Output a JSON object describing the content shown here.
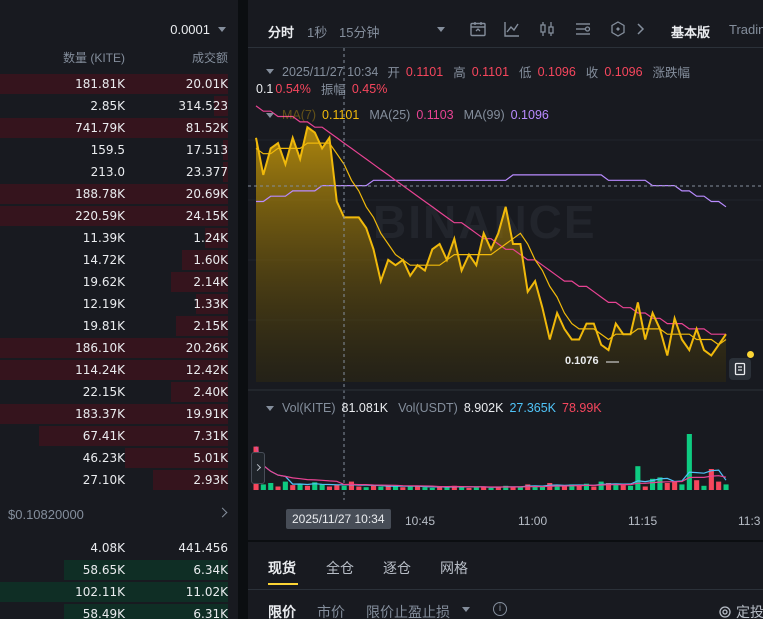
{
  "orderbook": {
    "precision": "0.0001",
    "header": {
      "qty": "数量 (KITE)",
      "amount": "成交额"
    },
    "asks": [
      {
        "qty": "181.81K",
        "amount": "20.01K",
        "depth": 1.0
      },
      {
        "qty": "2.85K",
        "amount": "314.523",
        "depth": 0.06
      },
      {
        "qty": "741.79K",
        "amount": "81.52K",
        "depth": 1.0
      },
      {
        "qty": "159.5",
        "amount": "17.513",
        "depth": 0.02
      },
      {
        "qty": "213.0",
        "amount": "23.377",
        "depth": 0.02
      },
      {
        "qty": "188.78K",
        "amount": "20.69K",
        "depth": 1.0
      },
      {
        "qty": "220.59K",
        "amount": "24.15K",
        "depth": 1.0
      },
      {
        "qty": "11.39K",
        "amount": "1.24K",
        "depth": 0.1
      },
      {
        "qty": "14.72K",
        "amount": "1.60K",
        "depth": 0.2
      },
      {
        "qty": "19.62K",
        "amount": "2.14K",
        "depth": 0.25
      },
      {
        "qty": "12.19K",
        "amount": "1.33K",
        "depth": 0.14
      },
      {
        "qty": "19.81K",
        "amount": "2.15K",
        "depth": 0.23
      },
      {
        "qty": "186.10K",
        "amount": "20.26K",
        "depth": 1.0
      },
      {
        "qty": "114.24K",
        "amount": "12.42K",
        "depth": 1.0
      },
      {
        "qty": "22.15K",
        "amount": "2.40K",
        "depth": 0.25
      },
      {
        "qty": "183.37K",
        "amount": "19.91K",
        "depth": 1.0
      },
      {
        "qty": "67.41K",
        "amount": "7.31K",
        "depth": 0.83
      },
      {
        "qty": "46.23K",
        "amount": "5.01K",
        "depth": 0.45
      },
      {
        "qty": "27.10K",
        "amount": "2.93K",
        "depth": 0.33
      }
    ],
    "mid_price": "$0.10820000",
    "bids": [
      {
        "qty": "4.08K",
        "amount": "441.456",
        "depth": 0.0
      },
      {
        "qty": "58.65K",
        "amount": "6.34K",
        "depth": 0.72
      },
      {
        "qty": "102.11K",
        "amount": "11.02K",
        "depth": 1.0
      },
      {
        "qty": "58.49K",
        "amount": "6.31K",
        "depth": 0.72
      }
    ]
  },
  "toolbar": {
    "tabs": [
      "分时",
      "1秒",
      "15分钟"
    ],
    "basic": "基本版",
    "trading": "TradingView"
  },
  "legend": {
    "date": "2025/11/27 10:34",
    "open_label": "开",
    "open": "0.1101",
    "high_label": "高",
    "high": "0.1101",
    "low_label": "低",
    "low": "0.1096",
    "close_label": "收",
    "close": "0.1096",
    "change_label": "涨跌幅",
    "change": "0.54%",
    "change_partial": "0.1",
    "amp_label": "振幅",
    "amp": "0.45%",
    "ma_label": "MA(7)",
    "ma7": "0.1101",
    "ma25_label": "MA(25)",
    "ma25": "0.1103",
    "ma99_label": "MA(99)",
    "ma99": "0.1096",
    "vol_label": "Vol(KITE)",
    "vol": "81.081K",
    "volusdt_label": "Vol(USDT)",
    "volusdt": "8.902K",
    "vol_ma1": "27.365K",
    "vol_ma2": "78.99K"
  },
  "chart": {
    "watermark": "BINANCE",
    "low_marker": "0.1076",
    "x_ticks": [
      "10:45",
      "11:00",
      "11:15",
      "11:3"
    ],
    "crosshair_time": "2025/11/27 10:34",
    "colors": {
      "price_line": "#f0b90b",
      "ma7": "#f0b90b",
      "ma25": "#e84393",
      "ma99": "#b98bff",
      "up": "#0ecb81",
      "down": "#f6465d"
    }
  },
  "chart_data": {
    "type": "line",
    "title": "",
    "xlabel": "",
    "ylabel": "",
    "x_range": [
      "10:28",
      "11:34"
    ],
    "ylim": [
      0.107,
      0.1125
    ],
    "price": [
      0.1116,
      0.1109,
      0.1114,
      0.1115,
      0.1111,
      0.1116,
      0.1112,
      0.1118,
      0.1117,
      0.1114,
      0.1116,
      0.1104,
      0.1101,
      0.1101,
      0.1101,
      0.1099,
      0.1095,
      0.1089,
      0.1093,
      0.1092,
      0.1093,
      0.109,
      0.1092,
      0.1091,
      0.1095,
      0.1096,
      0.1093,
      0.1097,
      0.1091,
      0.1094,
      0.1092,
      0.1098,
      0.1095,
      0.1098,
      0.1103,
      0.1096,
      0.1096,
      0.1087,
      0.1089,
      0.1084,
      0.1078,
      0.1083,
      0.108,
      0.1078,
      0.1078,
      0.1081,
      0.1081,
      0.1077,
      0.1076,
      0.1081,
      0.1079,
      0.1079,
      0.1085,
      0.1078,
      0.1083,
      0.108,
      0.1075,
      0.1082,
      0.1078,
      0.1076,
      0.108,
      0.1076,
      0.1075,
      0.1077,
      0.1079
    ],
    "series": [
      {
        "name": "MA(7)",
        "values": [
          0.1114,
          0.1113,
          0.1113,
          0.1114,
          0.1114,
          0.1114,
          0.1114,
          0.1115,
          0.1115,
          0.1115,
          0.1115,
          0.1113,
          0.1111,
          0.1108,
          0.1106,
          0.1103,
          0.1101,
          0.1098,
          0.1096,
          0.1094,
          0.1093,
          0.1092,
          0.1092,
          0.1092,
          0.1092,
          0.1092,
          0.1093,
          0.1094,
          0.1094,
          0.1094,
          0.1094,
          0.1094,
          0.1094,
          0.1095,
          0.1096,
          0.1097,
          0.1098,
          0.1096,
          0.1093,
          0.1091,
          0.1088,
          0.1086,
          0.1083,
          0.1081,
          0.108,
          0.108,
          0.108,
          0.1079,
          0.1078,
          0.1079,
          0.1079,
          0.1079,
          0.108,
          0.108,
          0.108,
          0.108,
          0.1079,
          0.1079,
          0.1079,
          0.1079,
          0.1078,
          0.1078,
          0.1078,
          0.1077,
          0.1078
        ]
      },
      {
        "name": "MA(25)",
        "values": [
          0.1122,
          0.1121,
          0.1121,
          0.112,
          0.112,
          0.112,
          0.1119,
          0.1119,
          0.1118,
          0.1118,
          0.1117,
          0.1116,
          0.1115,
          0.1114,
          0.1113,
          0.1112,
          0.1111,
          0.111,
          0.1109,
          0.1108,
          0.1107,
          0.1106,
          0.1105,
          0.1104,
          0.1103,
          0.1102,
          0.1101,
          0.11,
          0.11,
          0.1099,
          0.1098,
          0.1097,
          0.1097,
          0.1096,
          0.1095,
          0.1095,
          0.1094,
          0.1093,
          0.1093,
          0.1092,
          0.1091,
          0.109,
          0.1089,
          0.1089,
          0.1088,
          0.1088,
          0.1087,
          0.1086,
          0.1085,
          0.1085,
          0.1084,
          0.1084,
          0.1083,
          0.1083,
          0.1082,
          0.1082,
          0.1081,
          0.1081,
          0.1081,
          0.108,
          0.108,
          0.108,
          0.1079,
          0.1079,
          0.1079
        ]
      },
      {
        "name": "MA(99)",
        "values": [
          0.1104,
          0.1104,
          0.1105,
          0.1105,
          0.1105,
          0.1106,
          0.1106,
          0.1106,
          0.1106,
          0.1107,
          0.1107,
          0.1107,
          0.1107,
          0.1107,
          0.1107,
          0.1107,
          0.1108,
          0.1108,
          0.1108,
          0.1108,
          0.1108,
          0.1108,
          0.1108,
          0.1108,
          0.1108,
          0.1108,
          0.1108,
          0.1108,
          0.1108,
          0.1108,
          0.1108,
          0.1108,
          0.1108,
          0.1108,
          0.1108,
          0.1109,
          0.1109,
          0.1109,
          0.1109,
          0.1109,
          0.1109,
          0.1109,
          0.1109,
          0.1109,
          0.1109,
          0.1109,
          0.1109,
          0.1109,
          0.1108,
          0.1108,
          0.1108,
          0.1108,
          0.1108,
          0.1108,
          0.1107,
          0.1107,
          0.1107,
          0.1107,
          0.1106,
          0.1106,
          0.1105,
          0.1105,
          0.1104,
          0.1104,
          0.1103
        ]
      }
    ],
    "volume": [
      0.62,
      0.08,
      0.1,
      0.05,
      0.12,
      0.07,
      0.09,
      0.06,
      0.11,
      0.08,
      0.05,
      0.07,
      0.06,
      0.12,
      0.05,
      0.04,
      0.06,
      0.05,
      0.07,
      0.05,
      0.04,
      0.06,
      0.05,
      0.04,
      0.03,
      0.05,
      0.04,
      0.06,
      0.04,
      0.03,
      0.05,
      0.04,
      0.03,
      0.05,
      0.06,
      0.04,
      0.05,
      0.08,
      0.06,
      0.05,
      0.1,
      0.07,
      0.05,
      0.08,
      0.06,
      0.09,
      0.05,
      0.12,
      0.1,
      0.08,
      0.07,
      0.06,
      0.34,
      0.05,
      0.16,
      0.18,
      0.1,
      0.12,
      0.08,
      0.8,
      0.14,
      0.06,
      0.3,
      0.12,
      0.08
    ],
    "volume_up": [
      0,
      1,
      1,
      0,
      1,
      0,
      1,
      0,
      1,
      1,
      0,
      0,
      1,
      0,
      0,
      1,
      0,
      1,
      0,
      1,
      0,
      1,
      0,
      1,
      1,
      0,
      1,
      0,
      1,
      0,
      1,
      0,
      1,
      0,
      1,
      0,
      1,
      0,
      1,
      1,
      0,
      1,
      0,
      1,
      0,
      1,
      0,
      1,
      0,
      1,
      0,
      1,
      1,
      0,
      1,
      1,
      0,
      0,
      1,
      1,
      0,
      1,
      0,
      0,
      1
    ]
  },
  "trade_panel": {
    "tabs": [
      "现货",
      "全仓",
      "逐仓",
      "网格"
    ],
    "sub_tabs": [
      "限价",
      "市价",
      "限价止盈止损"
    ],
    "right": "定投"
  }
}
